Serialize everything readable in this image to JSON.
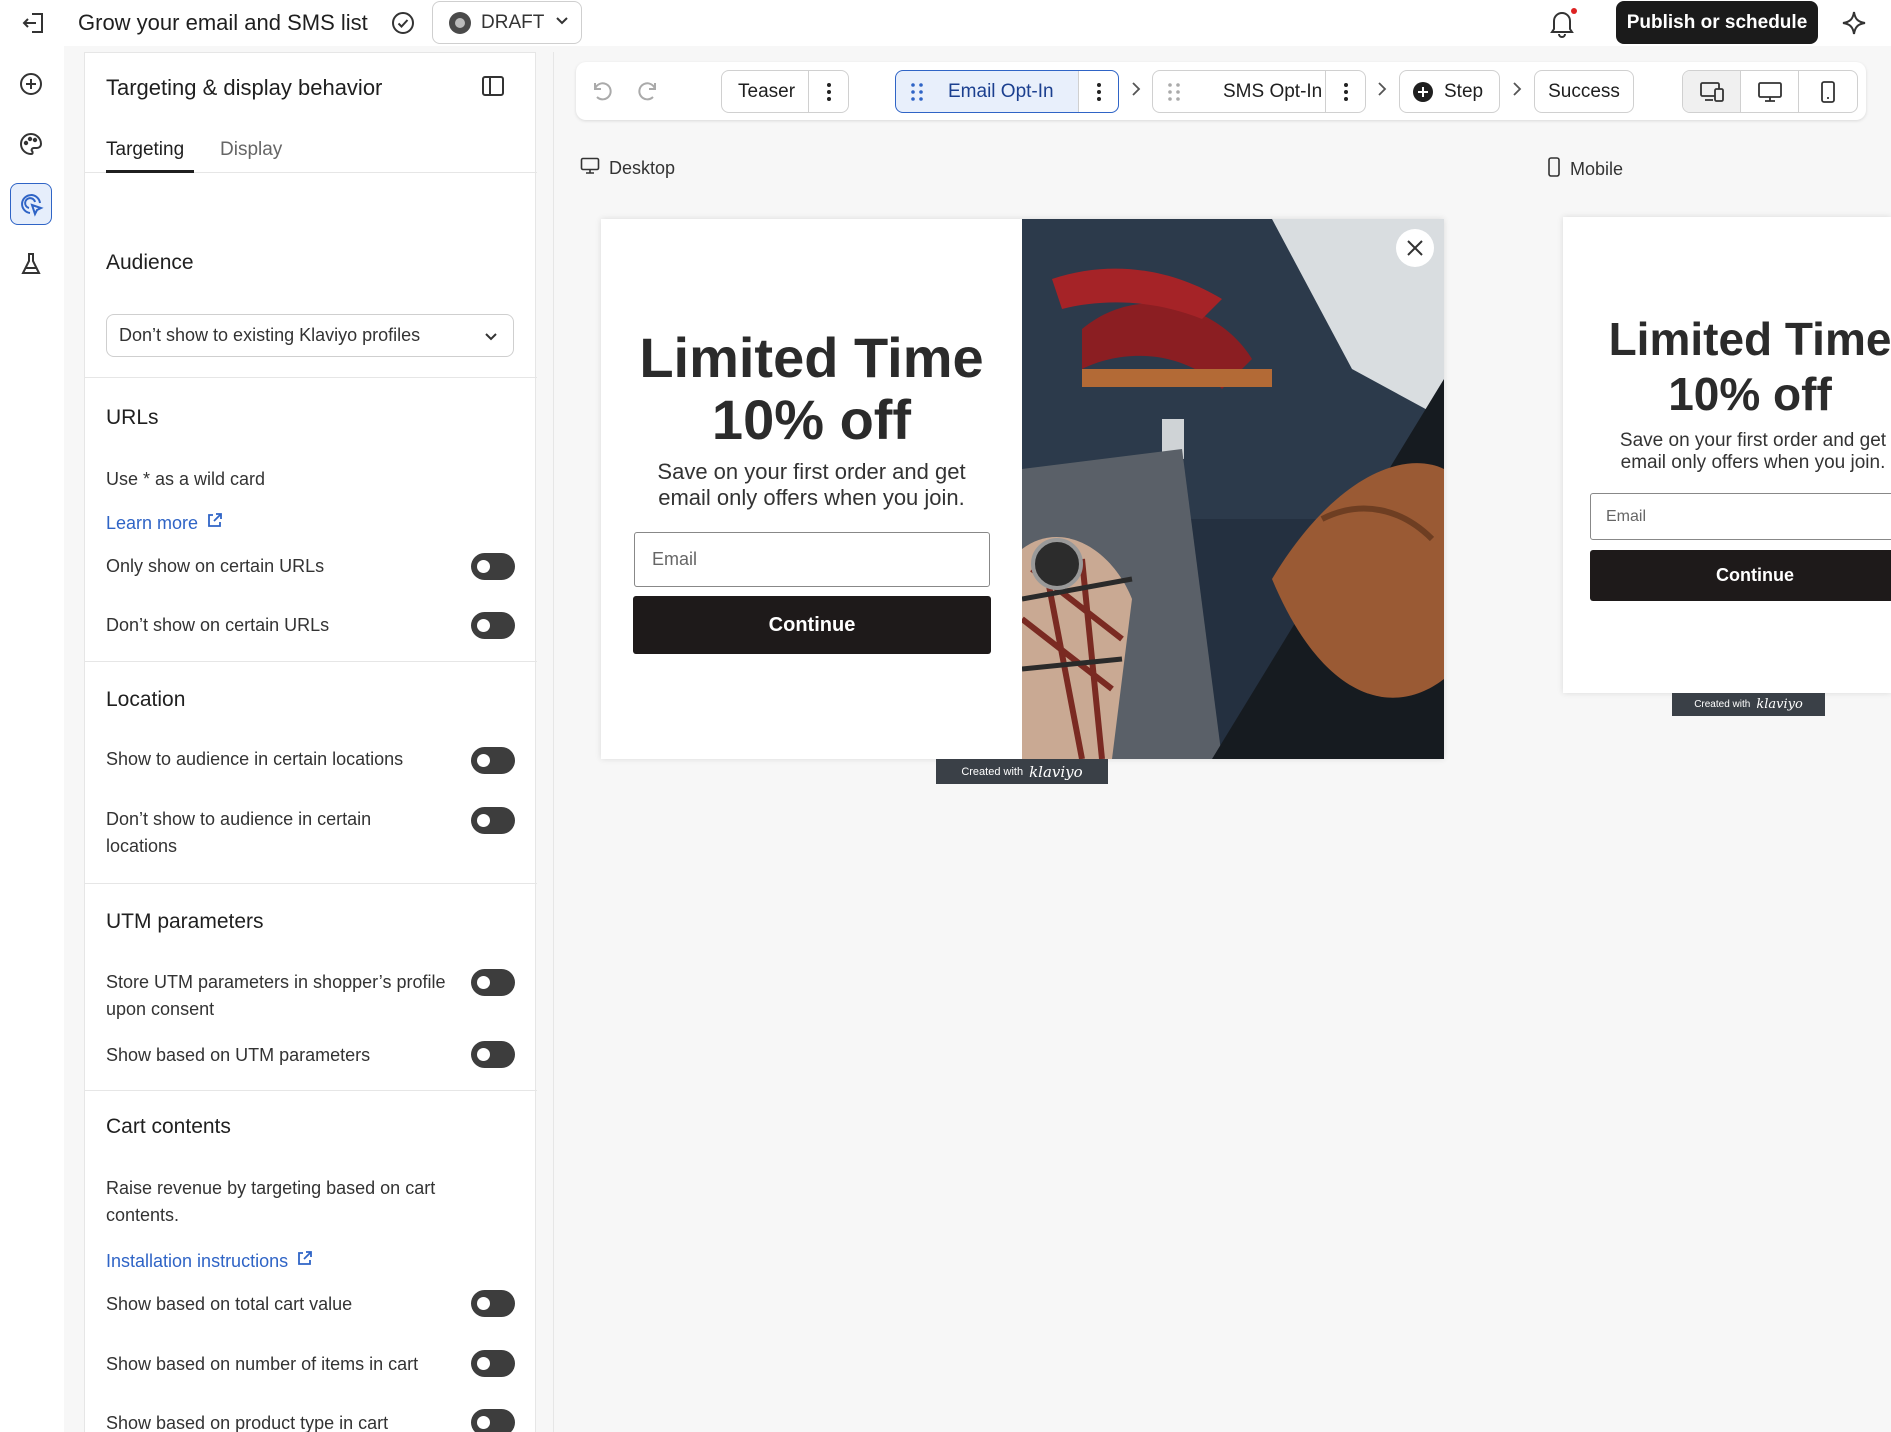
{
  "topbar": {
    "title": "Grow your email and SMS list",
    "status": "DRAFT",
    "publish_label": "Publish or schedule"
  },
  "rail": {
    "items": [
      "add-icon",
      "palette-icon",
      "targeting-icon",
      "flask-icon"
    ],
    "active": "targeting-icon"
  },
  "panel": {
    "title": "Targeting & display behavior",
    "tabs": [
      "Targeting",
      "Display"
    ],
    "active_tab": "Targeting",
    "audience": {
      "heading": "Audience",
      "selected": "Don’t show to existing Klaviyo profiles"
    },
    "urls": {
      "heading": "URLs",
      "hint": "Use * as a wild card",
      "learn_more": "Learn more",
      "only_show": "Only show on certain URLs",
      "dont_show": "Don’t show on certain URLs"
    },
    "location": {
      "heading": "Location",
      "show": "Show to audience in certain locations",
      "dont_show_line1": "Don’t show to audience in certain",
      "dont_show_line2": "locations"
    },
    "utm": {
      "heading": "UTM parameters",
      "store_line1": "Store UTM parameters in shopper’s profile",
      "store_line2": "upon consent",
      "show": "Show based on UTM parameters"
    },
    "cart": {
      "heading": "Cart contents",
      "desc_line1": "Raise revenue by targeting based on cart",
      "desc_line2": "contents.",
      "install": "Installation instructions",
      "total": "Show based on total cart value",
      "items": "Show based on number of items in cart",
      "product": "Show based on product type in cart"
    }
  },
  "stepbar": {
    "steps": [
      "Teaser",
      "Email Opt-In",
      "SMS Opt-In",
      "Step",
      "Success"
    ],
    "active_step": "Email Opt-In"
  },
  "preview": {
    "desktop_label": "Desktop",
    "mobile_label": "Mobile",
    "headline1": "Limited Time",
    "headline2": "10% off",
    "sub_line1": "Save on your first order and get",
    "sub_line2": "email only offers when you join.",
    "email_placeholder": "Email",
    "continue_label": "Continue",
    "created_with": "Created with",
    "brand": "klaviyo"
  },
  "colors": {
    "accent": "#2f64c6",
    "button_dark": "#1b1b1b"
  }
}
